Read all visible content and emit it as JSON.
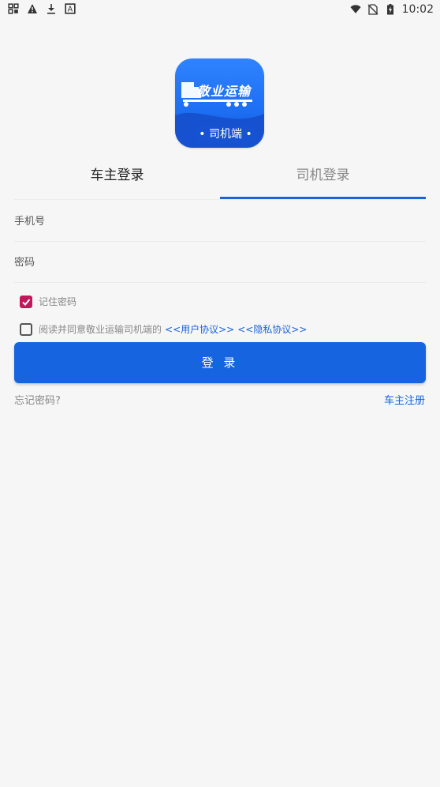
{
  "status_bar": {
    "time": "10:02",
    "left_icons": [
      "media-icon",
      "warning-icon",
      "download-icon",
      "translate-icon"
    ],
    "right_icons": [
      "wifi-icon",
      "no-sim-icon",
      "battery-charging-icon"
    ]
  },
  "logo": {
    "title": "敬业运输",
    "subtitle": "• 司机端 •"
  },
  "tabs": {
    "owner_login": "车主登录",
    "driver_login": "司机登录",
    "active": "driver_login"
  },
  "form": {
    "phone_placeholder": "手机号",
    "phone_value": "",
    "password_placeholder": "密码",
    "password_value": "",
    "remember_label": "记住密码",
    "remember_checked": true,
    "agree_text": "阅读并同意敬业运输司机端的",
    "user_agreement": "<<用户协议>>",
    "privacy_policy": "<<隐私协议>>",
    "agree_checked": false,
    "login_button": "登 录"
  },
  "footer": {
    "forgot_password": "忘记密码?",
    "owner_register": "车主注册"
  },
  "colors": {
    "primary": "#1764e0",
    "checkbox_checked": "#c2185b",
    "background": "#f6f6f6"
  }
}
